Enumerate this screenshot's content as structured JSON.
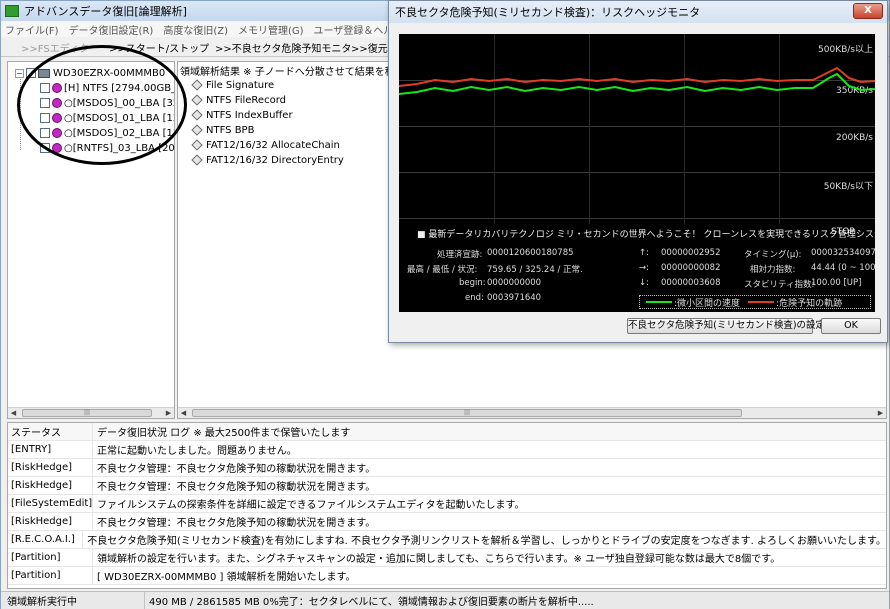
{
  "app": {
    "title": "アドバンスデータ復旧[論理解析]"
  },
  "menu": [
    "ファイル(F)",
    "データ復旧設定(R)",
    "高度な復旧(Z)",
    "メモリ管理(G)",
    "ユーザ登録＆ヘルプ(H)"
  ],
  "toolbar": {
    "fs_editor": ">>FSエディタ",
    "start_stop": ">>スタート/ストップ",
    "bad_sector": ">>不良セクタ危険予知モニタ",
    "restore": ">>復元実"
  },
  "tree": {
    "root": "WD30EZRX-00MMMB0",
    "items": [
      "[H] NTFS [2794.00GB_0c",
      "○[MSDOS]_00_LBA [32]",
      "○[MSDOS]_01_LBA [128",
      "○[MSDOS]_02_LBA [133",
      "○[RNTFS]_03_LBA [2048"
    ]
  },
  "results": {
    "header": "領域解析結果 ※ 子ノードへ分散させて結果を積みます",
    "items": [
      "File Signature",
      "NTFS FileRecord",
      "NTFS IndexBuffer",
      "NTFS BPB",
      "FAT12/16/32 AllocateChain",
      "FAT12/16/32 DirectoryEntry"
    ]
  },
  "log": {
    "header": {
      "col1": "ステータス",
      "col2": "データ復旧状況 ログ ※ 最大2500件まで保管いたします"
    },
    "rows": [
      {
        "status": "[ENTRY]",
        "message": "正常に起動いたしました。問題ありません。"
      },
      {
        "status": "[RiskHedge]",
        "message": "不良セクタ管理：不良セクタ危険予知の稼動状況を開きます。"
      },
      {
        "status": "[RiskHedge]",
        "message": "不良セクタ管理：不良セクタ危険予知の稼動状況を開きます。"
      },
      {
        "status": "[FileSystemEdit]",
        "message": "ファイルシステムの探索条件を詳細に設定できるファイルシステムエディタを起動いたします。"
      },
      {
        "status": "[RiskHedge]",
        "message": "不良セクタ管理：不良セクタ危険予知の稼動状況を開きます。"
      },
      {
        "status": "[R.E.C.O.A.I.]",
        "message": "不良セクタ危険予知(ミリセカンド検査)を有効にしますね. 不良セクタ予測リンクリストを解析＆学習し、しっかりとドライブの安定度をつなぎます. よろしくお願いいたします。"
      },
      {
        "status": "[Partition]",
        "message": "領域解析の設定を行います。また、シグネチャスキャンの設定・追加に関しましても、こちらで行います。※ ユーザ独自登録可能な数は最大で8個です。"
      },
      {
        "status": "[Partition]",
        "message": "[ WD30EZRX-00MMMB0 ] 領域解析を開始いたします。"
      }
    ]
  },
  "status": {
    "state": "領域解析実行中",
    "progress": "490 MB / 2861585 MB 0%完了：セクタレベルにて、領域情報および復旧要素の断片を解析中....."
  },
  "monitor": {
    "title": "不良セクタ危険予知(ミリセカンド検査)：リスクヘッジモニタ",
    "close": "X",
    "axis_labels": [
      "500KB/s以上",
      "350KB/s",
      "200KB/s",
      "50KB/s以下"
    ],
    "welcome": "■ 最新データリカバリテクノロジ ミリ・セカンドの世界へようこそ！ クローンレスを実現できるリスク管理システム",
    "stop": "STOP",
    "stats": {
      "processed_label": "処理済宣跡:",
      "processed_value": "0000120600180785",
      "minmax_label": "最高 / 最低 / 状況:",
      "minmax_value": "759.65 / 325.24 / 正常.",
      "begin_label": "begin:",
      "begin_value": "0000000000",
      "end_label": "end:",
      "end_value": "0003971640",
      "up_label": "↑:",
      "up_value": "00000002952",
      "right_label": "→:",
      "right_value": "00000000082",
      "down_label": "↓:",
      "down_value": "00000003608",
      "timing_label": "タイミング(μ):",
      "timing_value": "0000325340972",
      "relative_label": "相対力指数:",
      "relative_value": "44.44 (0 ~ 100)",
      "stability_label": "スタビリティ指数:",
      "stability_value": "100.00 [UP]"
    },
    "legend": {
      "green": ":微小区間の速度",
      "red": ":危険予知の軌跡"
    },
    "settings_button": "不良セクタ危険予知(ミリセカンド検査)の設定",
    "ok_button": "OK",
    "colors": {
      "green": "#19e619",
      "red": "#e03c20"
    }
  }
}
